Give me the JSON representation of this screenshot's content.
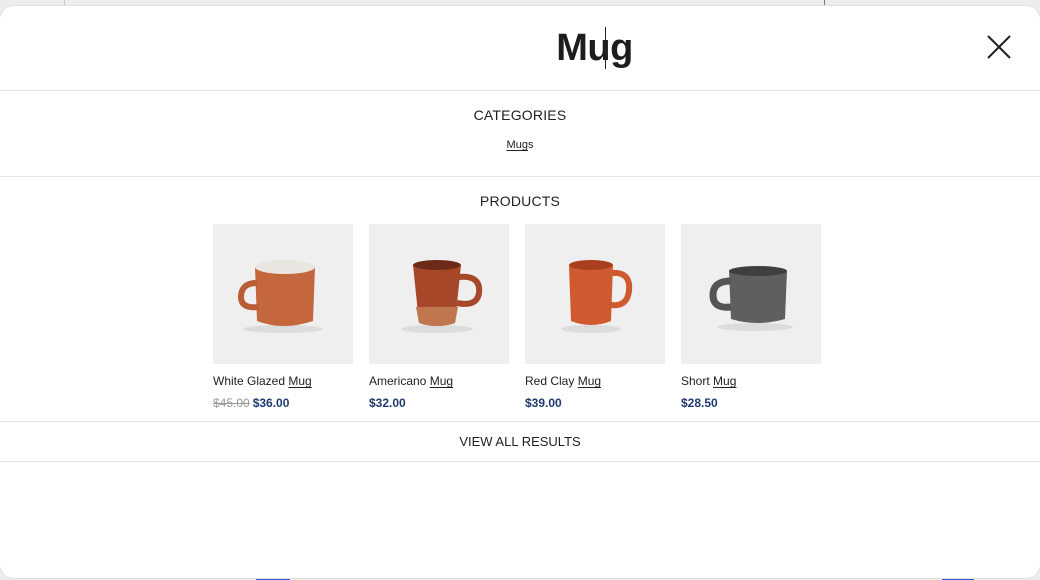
{
  "search": {
    "query": "Mug",
    "close_icon": "close-icon"
  },
  "categories": {
    "title": "CATEGORIES",
    "items": [
      {
        "label_match": "Mug",
        "label_rest": "s"
      }
    ]
  },
  "products": {
    "title": "PRODUCTS",
    "items": [
      {
        "name_prefix": "White Glazed",
        "name_match": "Mug",
        "old_price": "$45.00",
        "price": "$36.00",
        "image": "orange-mug-white-interior",
        "color": "#c4673d"
      },
      {
        "name_prefix": "Americano",
        "name_match": "Mug",
        "old_price": "",
        "price": "$32.00",
        "image": "rust-tapered-mug",
        "color": "#a74729"
      },
      {
        "name_prefix": "Red Clay",
        "name_match": "Mug",
        "old_price": "",
        "price": "$39.00",
        "image": "red-clay-mug",
        "color": "#cf5a30"
      },
      {
        "name_prefix": "Short",
        "name_match": "Mug",
        "old_price": "",
        "price": "$28.50",
        "image": "gray-short-mug",
        "color": "#5f5f5f"
      }
    ]
  },
  "footer": {
    "view_all_label": "VIEW ALL RESULTS"
  }
}
